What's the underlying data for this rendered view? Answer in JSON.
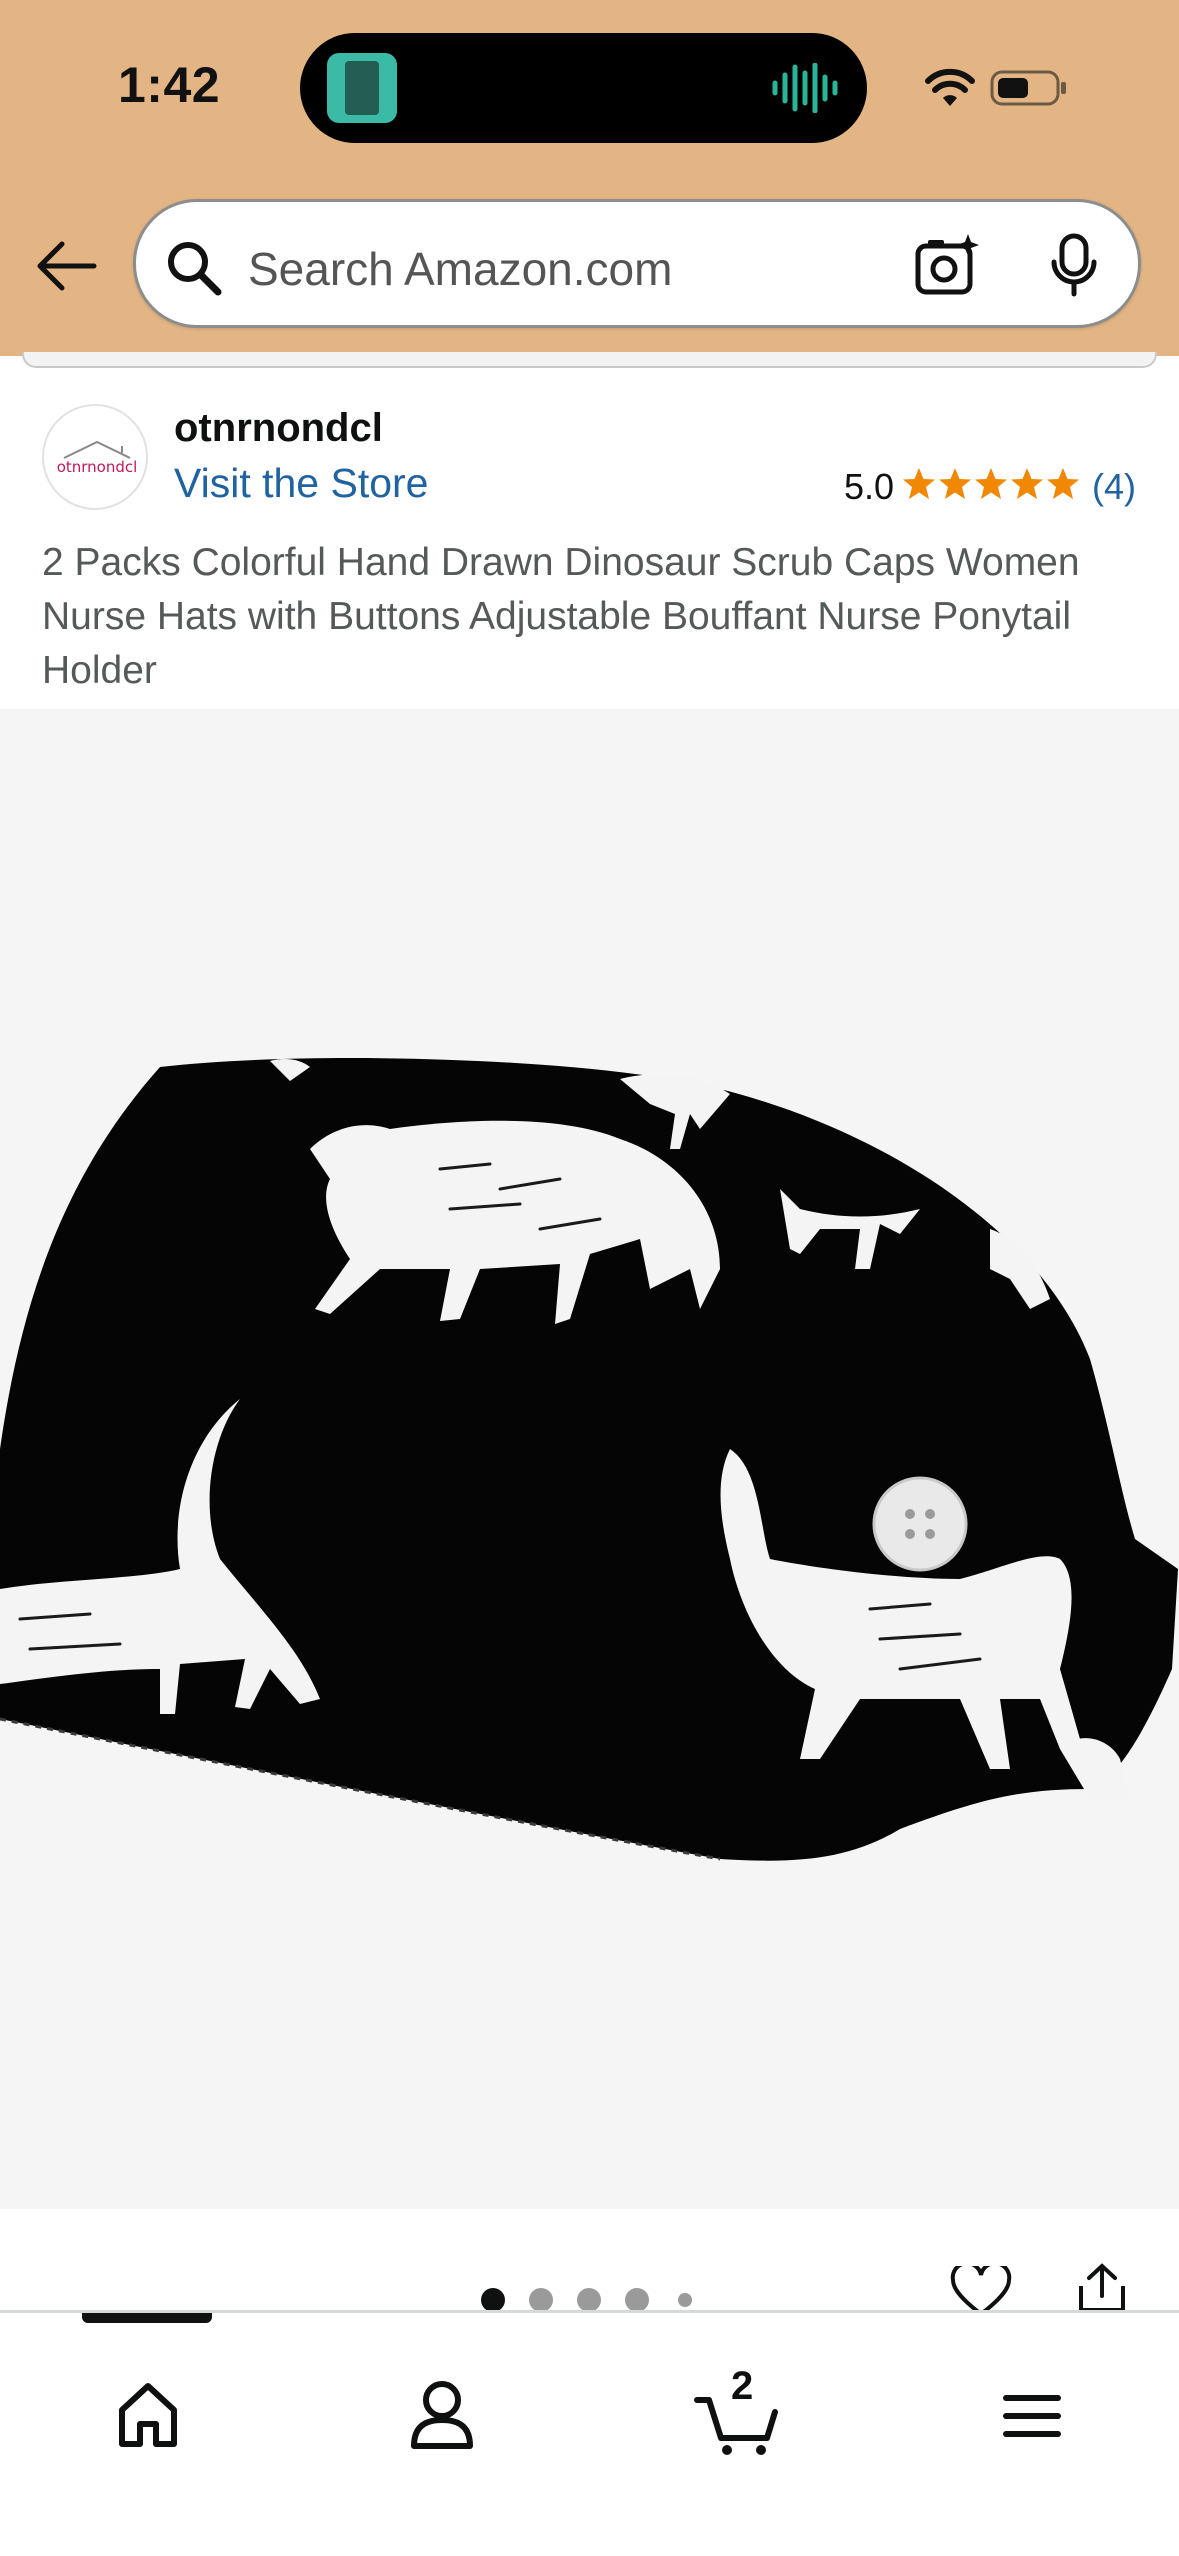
{
  "status_bar": {
    "time": "1:42",
    "icons": [
      "now-playing-thumbnail",
      "audio-waveform-icon",
      "wifi-icon",
      "battery-icon"
    ]
  },
  "header": {
    "search_placeholder": "Search Amazon.com",
    "icons": [
      "back-arrow-icon",
      "search-icon",
      "camera-icon",
      "microphone-icon"
    ],
    "background_color": "#e3b585"
  },
  "store": {
    "logo_text": "otnrnondcl",
    "name": "otnrnondcl",
    "visit_label": "Visit the Store",
    "rating": "5.0",
    "stars": 5,
    "review_count": "(4)"
  },
  "product": {
    "title": "2 Packs Colorful Hand Drawn Dinosaur Scrub Caps Women Nurse Hats with Buttons Adjustable Bouffant Nurse Ponytail Holder",
    "image_description_icon": "scrub-cap-image",
    "carousel": {
      "total": 5,
      "active": 1
    }
  },
  "actions": {
    "icons": [
      "heart-icon",
      "share-icon"
    ]
  },
  "bottom_nav": {
    "items": [
      "home-icon",
      "account-icon",
      "cart-icon",
      "menu-icon"
    ],
    "cart_count": "2",
    "active": "home"
  },
  "colors": {
    "link": "#2162a1",
    "star": "#f08804",
    "text": "#0f1111",
    "muted_text": "#565959"
  }
}
